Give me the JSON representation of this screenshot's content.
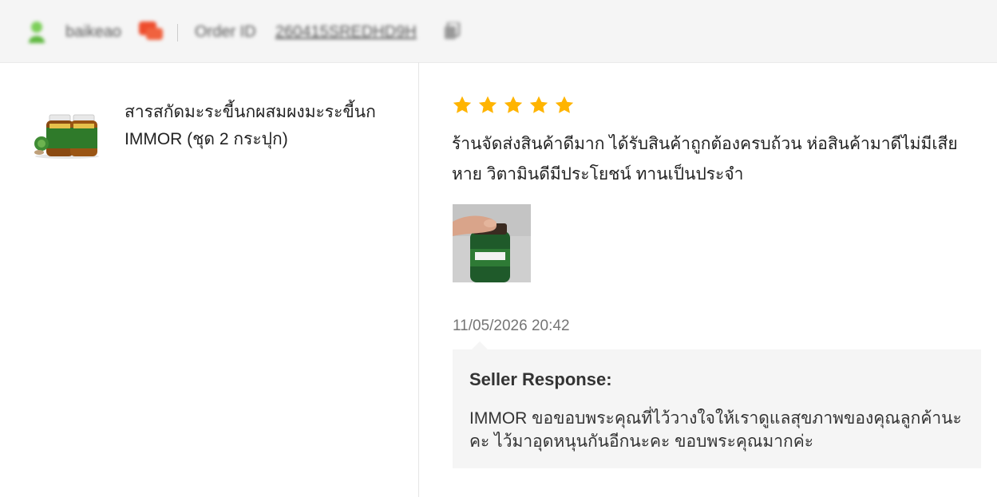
{
  "header": {
    "username": "baikeao",
    "order_label": "Order ID",
    "order_id": "260415SREDHD9H"
  },
  "product": {
    "name": "สารสกัดมะระขี้นกผสมผงมะระขี้นก IMMOR (ชุด 2 กระปุก)",
    "thumb_icon": "supplement-bottles-image"
  },
  "review": {
    "rating": 5,
    "rating_max": 5,
    "star_color": "#FFB400",
    "text": "ร้านจัดส่งสินค้าดีมาก ได้รับสินค้าถูกต้องครบถ้วน ห่อสินค้ามาดีไม่มีเสียหาย วิตามินดีมีประโยชน์ ทานเป็นประจำ",
    "photo_icon": "hand-holding-bottle-photo",
    "timestamp": "11/05/2026 20:42"
  },
  "seller_response": {
    "title": "Seller Response:",
    "text": "IMMOR ขอขอบพระคุณที่ไว้วางใจให้เราดูแลสุขภาพของคุณลูกค้านะคะ ไว้มาอุดหนุนกันอีกนะคะ ขอบพระคุณมากค่ะ"
  }
}
